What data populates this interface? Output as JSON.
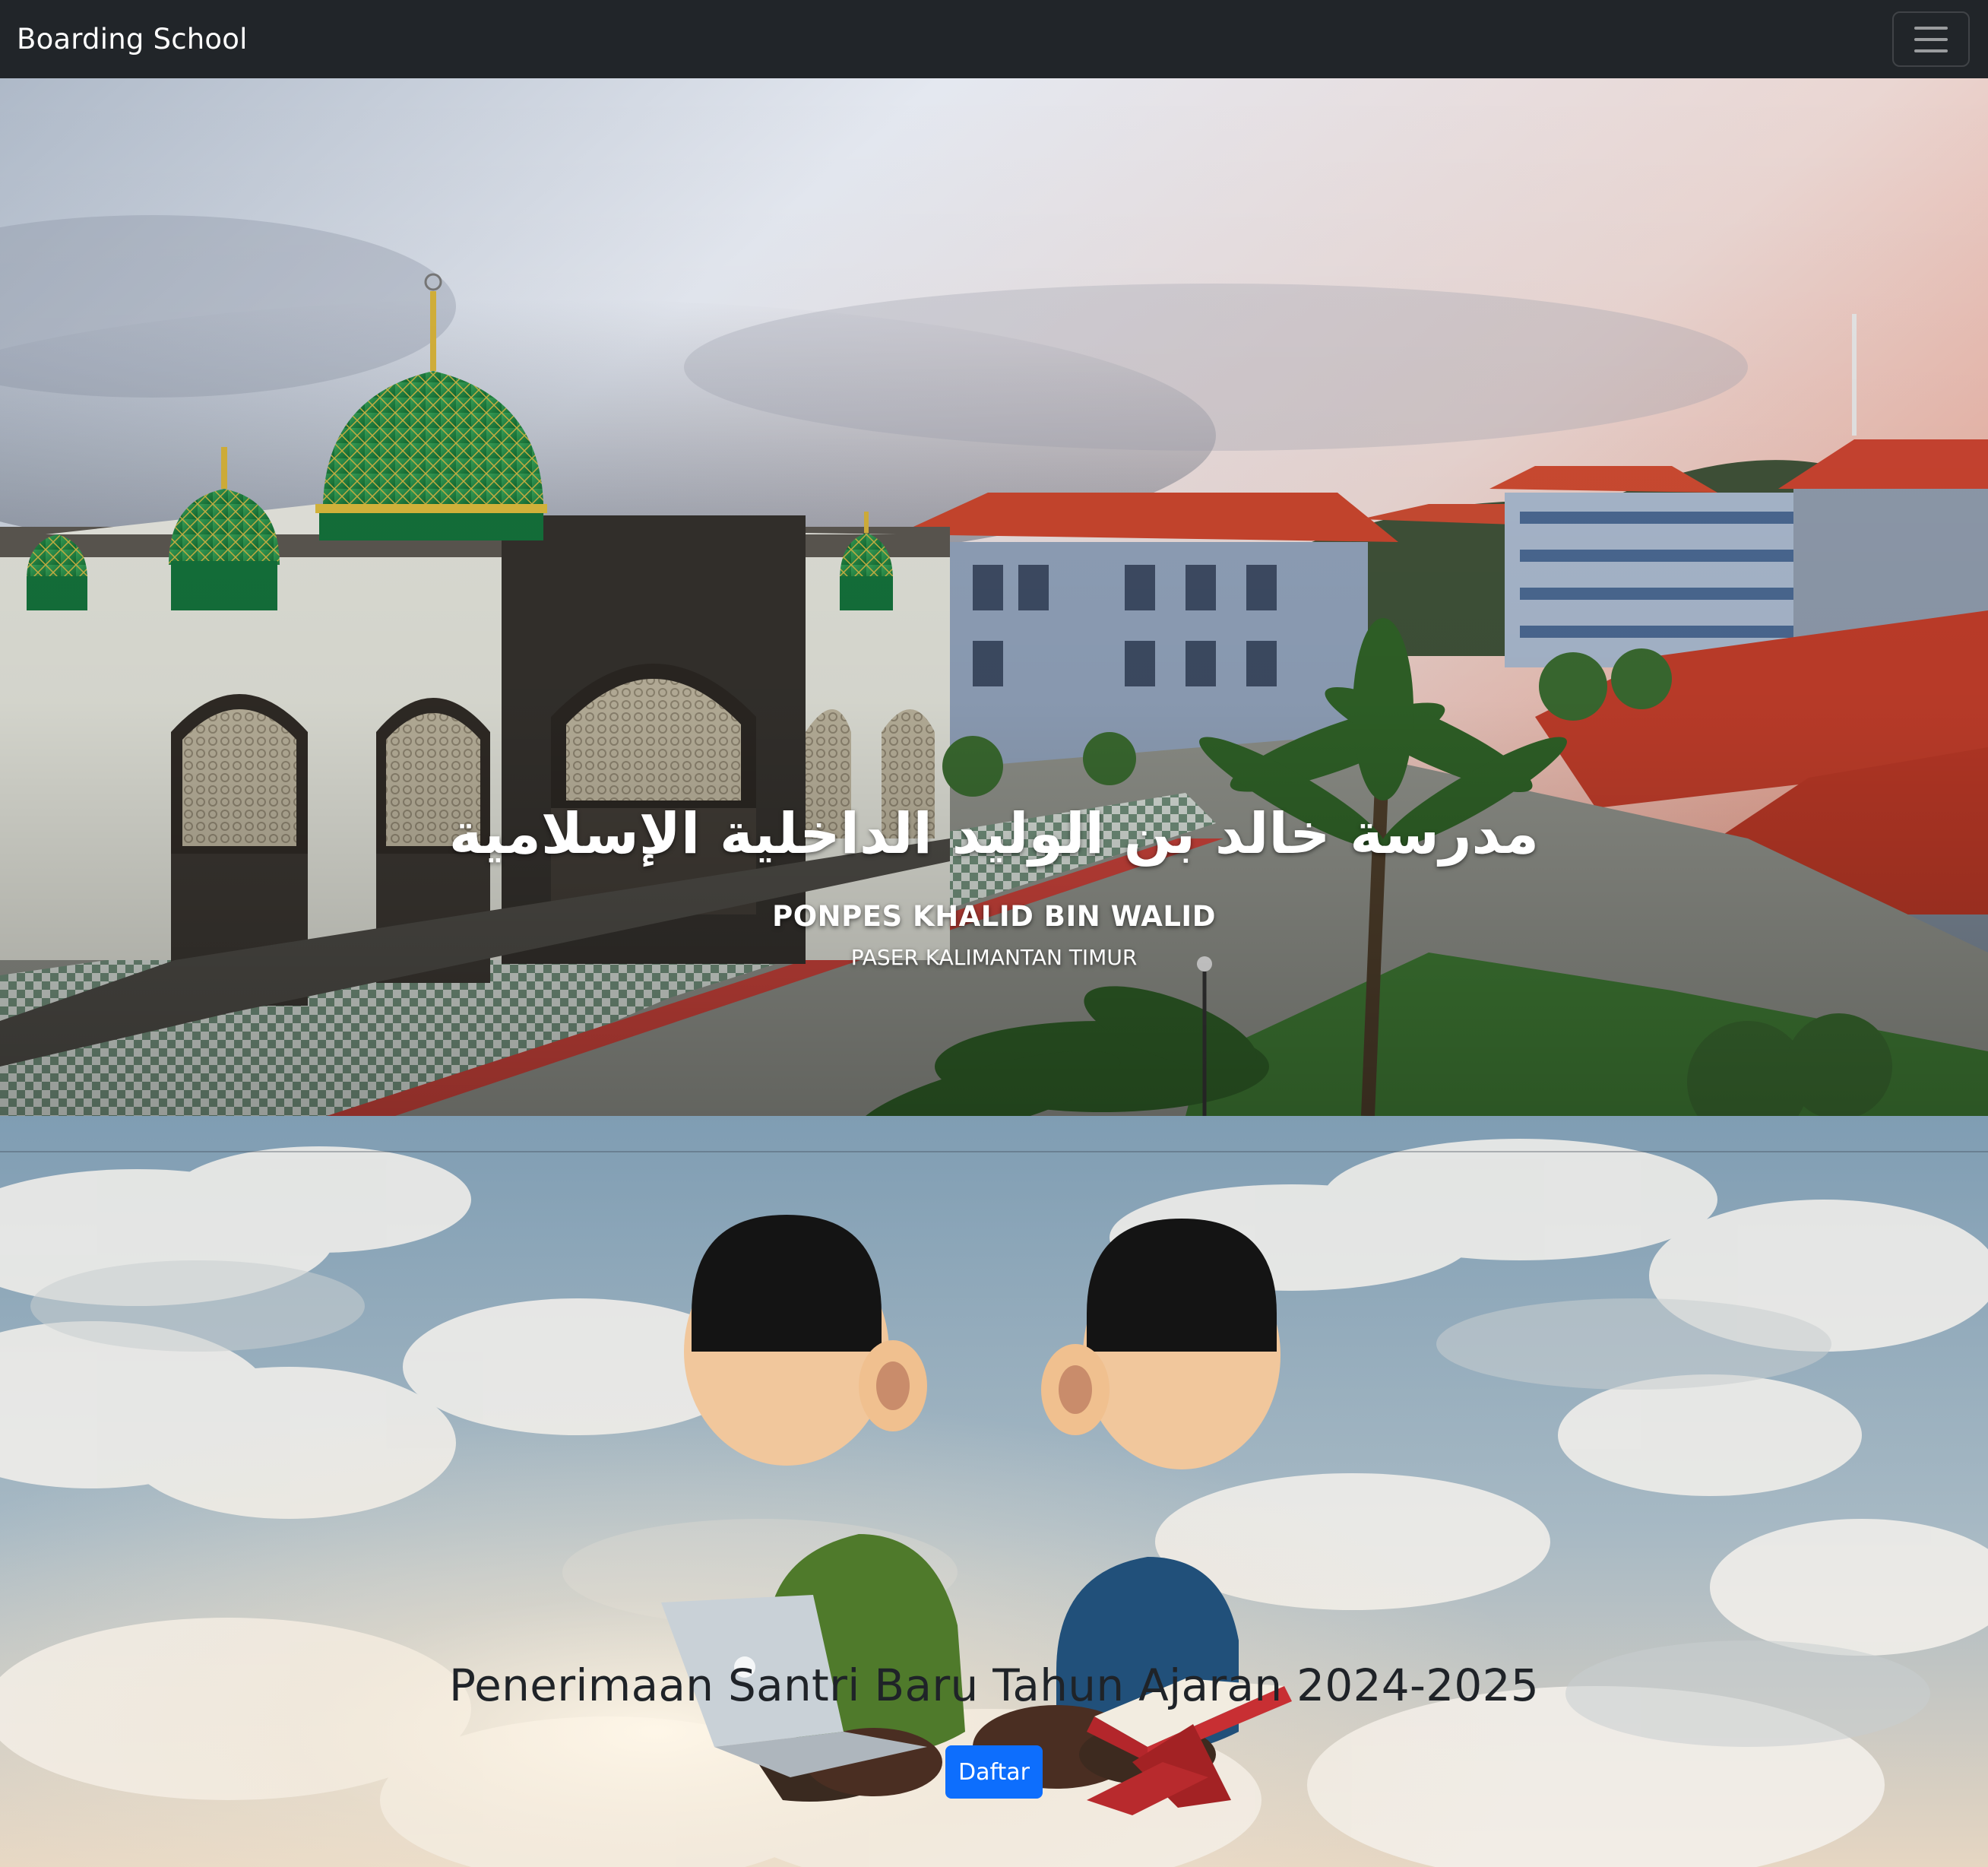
{
  "navbar": {
    "brand": "Boarding School",
    "toggler_icon": "hamburger-menu-icon"
  },
  "hero": {
    "arabic_title": "مدرسة خالد بن الوليد الداخلية الإسلامية",
    "school_name": "PONPES KHALID BIN WALID",
    "location": "PASER KALIMANTAN TIMUR"
  },
  "admission": {
    "title": "Penerimaan Santri Baru Tahun Ajaran 2024-2025",
    "button_label": "Daftar"
  },
  "colors": {
    "navbar_bg": "#212529",
    "primary_button": "#0d6efd"
  }
}
